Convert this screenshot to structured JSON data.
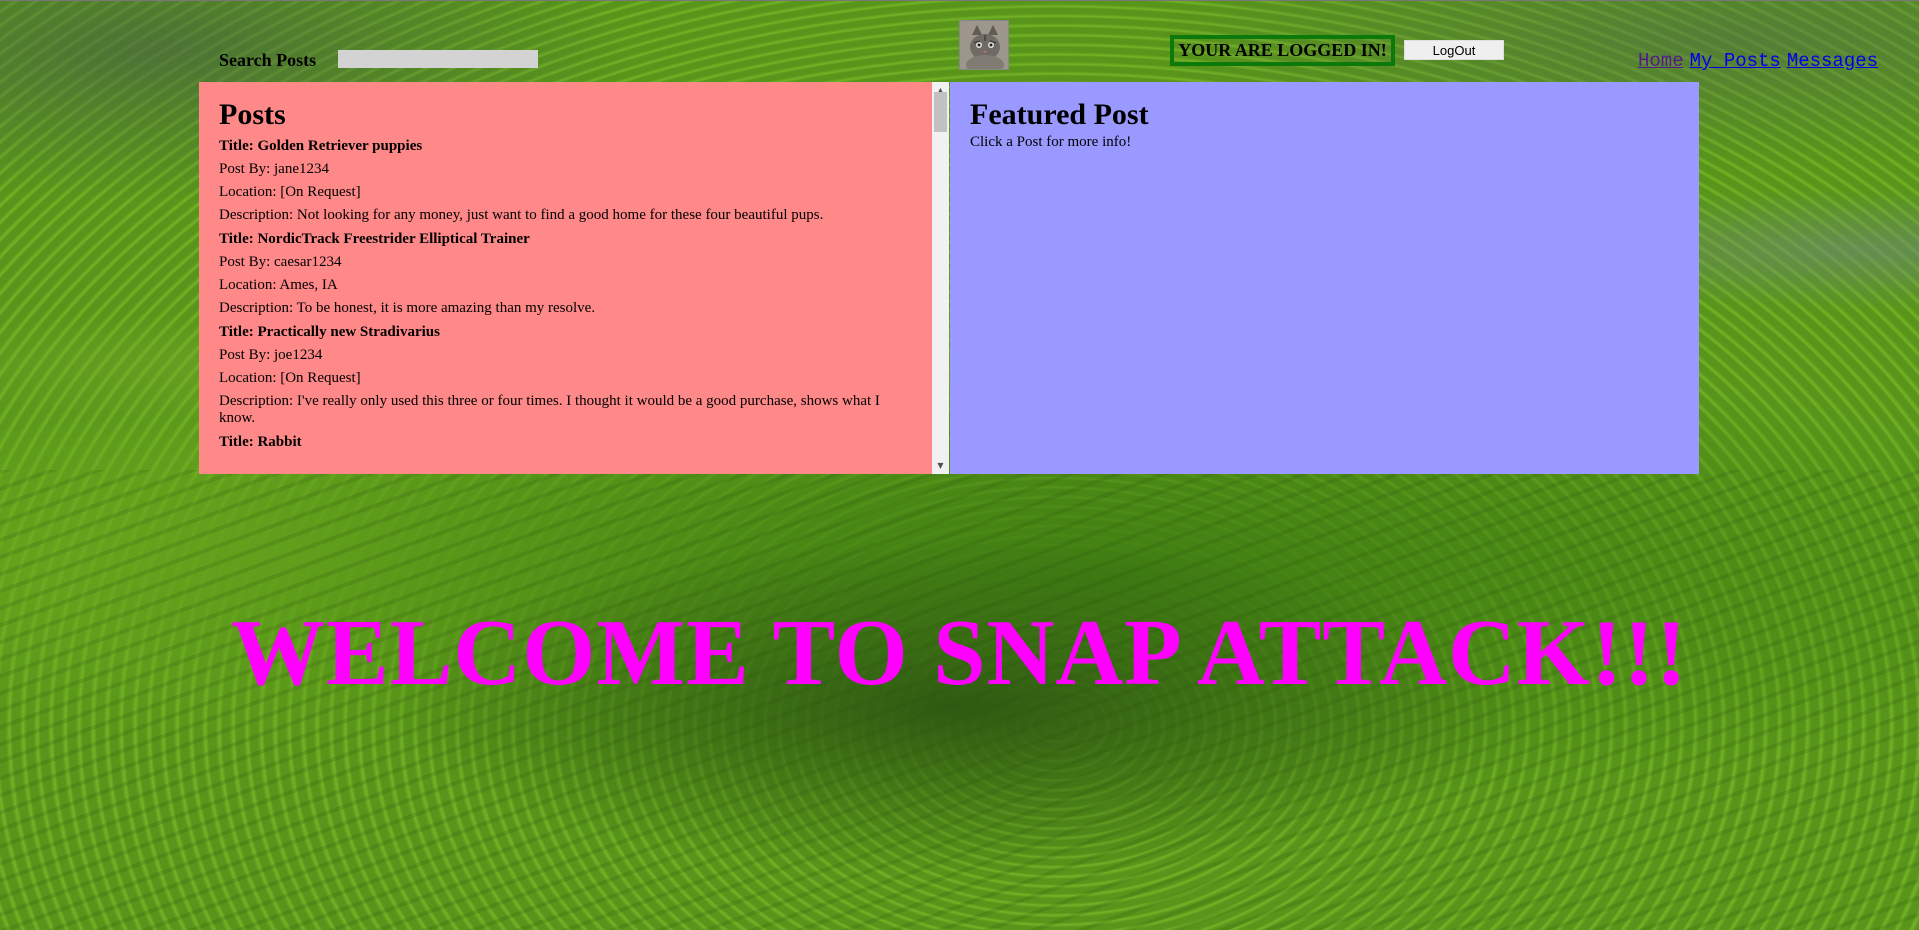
{
  "header": {
    "search_label": "Search Posts",
    "search_value": "",
    "login_status": "YOUR ARE LOGGED IN!",
    "logout_label": "LogOut",
    "nav": [
      {
        "label": "Home"
      },
      {
        "label": "My Posts"
      },
      {
        "label": "Messages"
      }
    ]
  },
  "posts_panel": {
    "title": "Posts",
    "posts": [
      {
        "title": "Title: Golden Retriever puppies",
        "by": "Post By: jane1234",
        "location": "Location: [On Request]",
        "description": "Description: Not looking for any money, just want to find a good home for these four beautiful pups."
      },
      {
        "title": "Title: NordicTrack Freestrider Elliptical Trainer",
        "by": "Post By: caesar1234",
        "location": "Location: Ames, IA",
        "description": "Description: To be honest, it is more amazing than my resolve."
      },
      {
        "title": "Title: Practically new Stradivarius",
        "by": "Post By: joe1234",
        "location": "Location: [On Request]",
        "description": "Description: I've really only used this three or four times. I thought it would be a good purchase, shows what I know."
      },
      {
        "title": "Title: Rabbit",
        "by": "",
        "location": "",
        "description": ""
      }
    ]
  },
  "featured_panel": {
    "title": "Featured Post",
    "hint": "Click a Post for more info!"
  },
  "welcome": "WELCOME TO SNAP ATTACK!!!",
  "colors": {
    "posts_bg": "#ff8888",
    "featured_bg": "#9999ff",
    "welcome_text": "#ff00ff",
    "login_border": "#0b7a0b"
  },
  "icons": {
    "avatar": "cat-avatar",
    "scroll_up": "scroll-up-arrow-icon",
    "scroll_down": "scroll-down-arrow-icon"
  }
}
